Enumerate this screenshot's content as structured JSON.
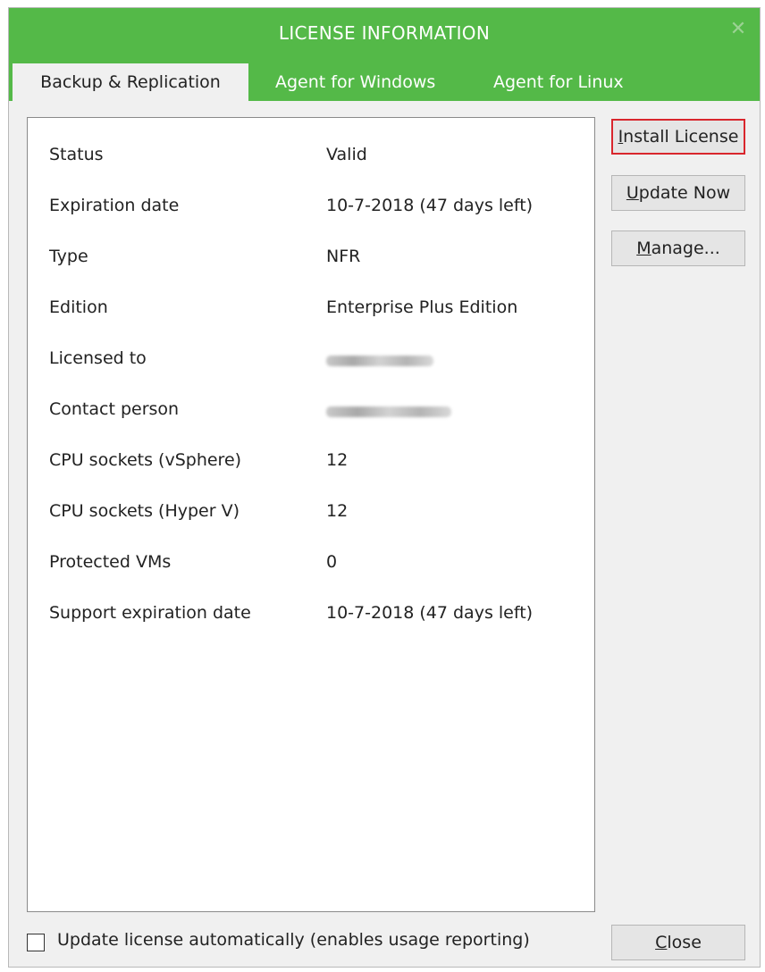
{
  "window": {
    "title": "LICENSE INFORMATION",
    "close_glyph": "✕"
  },
  "tabs": [
    {
      "label": "Backup & Replication",
      "active": true
    },
    {
      "label": "Agent for Windows",
      "active": false
    },
    {
      "label": "Agent for Linux",
      "active": false
    }
  ],
  "license": {
    "rows": [
      {
        "label": "Status",
        "value": "Valid"
      },
      {
        "label": "Expiration date",
        "value": "10-7-2018 (47 days left)"
      },
      {
        "label": "Type",
        "value": "NFR"
      },
      {
        "label": "Edition",
        "value": "Enterprise Plus Edition"
      },
      {
        "label": "Licensed to",
        "value": "",
        "redacted": true
      },
      {
        "label": "Contact person",
        "value": "",
        "redacted": true
      },
      {
        "label": "CPU sockets (vSphere)",
        "value": "12"
      },
      {
        "label": "CPU sockets (Hyper V)",
        "value": "12"
      },
      {
        "label": "Protected VMs",
        "value": "0"
      },
      {
        "label": "Support expiration date",
        "value": "10-7-2018 (47 days left)"
      }
    ]
  },
  "actions": {
    "install_license": {
      "prefix": "",
      "mnemonic": "I",
      "rest": "nstall License"
    },
    "update_now": {
      "prefix": "",
      "mnemonic": "U",
      "rest": "pdate Now"
    },
    "manage": {
      "prefix": "",
      "mnemonic": "M",
      "rest": "anage..."
    }
  },
  "footer": {
    "auto_update_label": "Update license automatically (enables usage reporting)",
    "auto_update_checked": false,
    "close": {
      "mnemonic": "C",
      "rest": "lose"
    }
  },
  "colors": {
    "titlebar": "#54b948",
    "highlight_border": "#d9262d"
  }
}
